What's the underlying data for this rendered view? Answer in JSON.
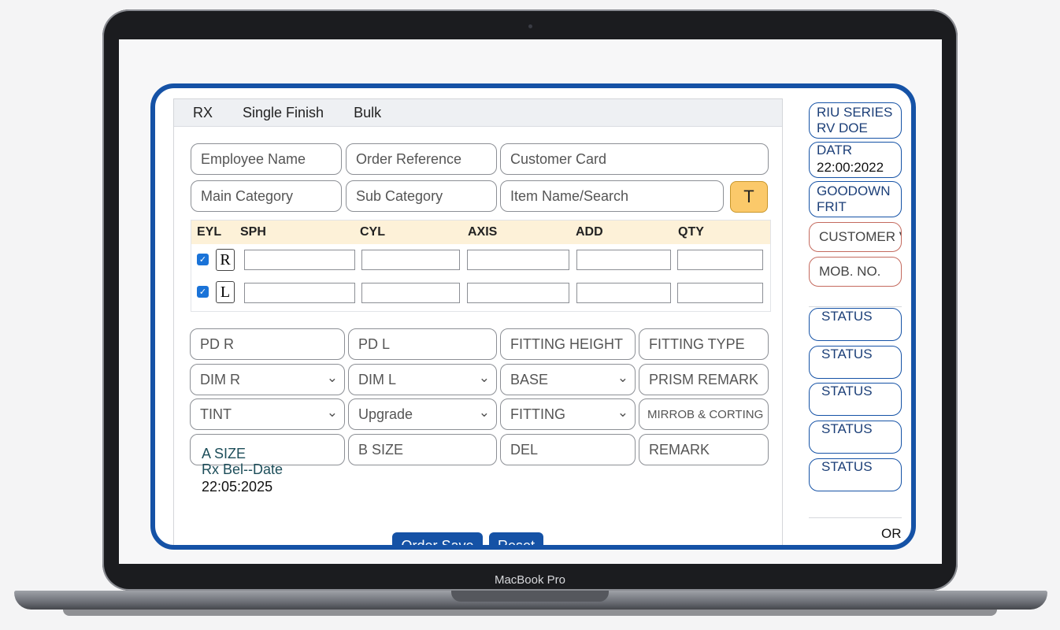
{
  "device": {
    "label": "MacBook Pro"
  },
  "tabs": [
    "RX",
    "Single Finish",
    "Bulk"
  ],
  "form": {
    "employee_name": "Employee Name",
    "order_reference": "Order Reference",
    "customer_card": "Customer Card",
    "main_category": "Main Category",
    "sub_category": "Sub Category",
    "item_search": "Item Name/Search",
    "t_button": "T"
  },
  "grid": {
    "headers": [
      "EYL",
      "SPH",
      "CYL",
      "AXIS",
      "ADD",
      "QTY"
    ],
    "rows": [
      {
        "eye": "R",
        "checked": true
      },
      {
        "eye": "L",
        "checked": true
      }
    ]
  },
  "fields": {
    "pd_r": "PD R",
    "pd_l": "PD L",
    "fitting_height": "FITTING HEIGHT",
    "fitting_type": "FITTING TYPE",
    "dim_r": "DIM R",
    "dim_l": "DIM L",
    "base": "BASE",
    "prism_remark": "PRISM REMARK",
    "tint": "TINT",
    "upgrade": "Upgrade",
    "fitting": "FITTING",
    "mirror_coating": "MIRROB & CORTING",
    "a_size": "A SIZE",
    "b_size": "B SIZE",
    "del": "DEL",
    "remark": "REMARK"
  },
  "rx_date": {
    "label": "Rx Bel--Date",
    "value": "22:05:2025"
  },
  "buttons": {
    "order_save": "Order Save",
    "reset": "Reset"
  },
  "side": {
    "series_line1": "RIU  SERIES",
    "series_line2": "RV  DOE",
    "date_label": "DATR",
    "date_value": "22:00:2022",
    "goodown_line1": "GOODOWN",
    "goodown_line2": "FRIT",
    "customer": "CUSTOMER V",
    "mobile": "MOB. NO.",
    "statuses": [
      "STATUS",
      "STATUS",
      "STATUS",
      "STATUS",
      "STATUS"
    ],
    "or_text": "OR"
  },
  "colors": {
    "accent": "#1552a6",
    "highlight": "#fbc96a",
    "header_row": "#fdf1d8"
  }
}
